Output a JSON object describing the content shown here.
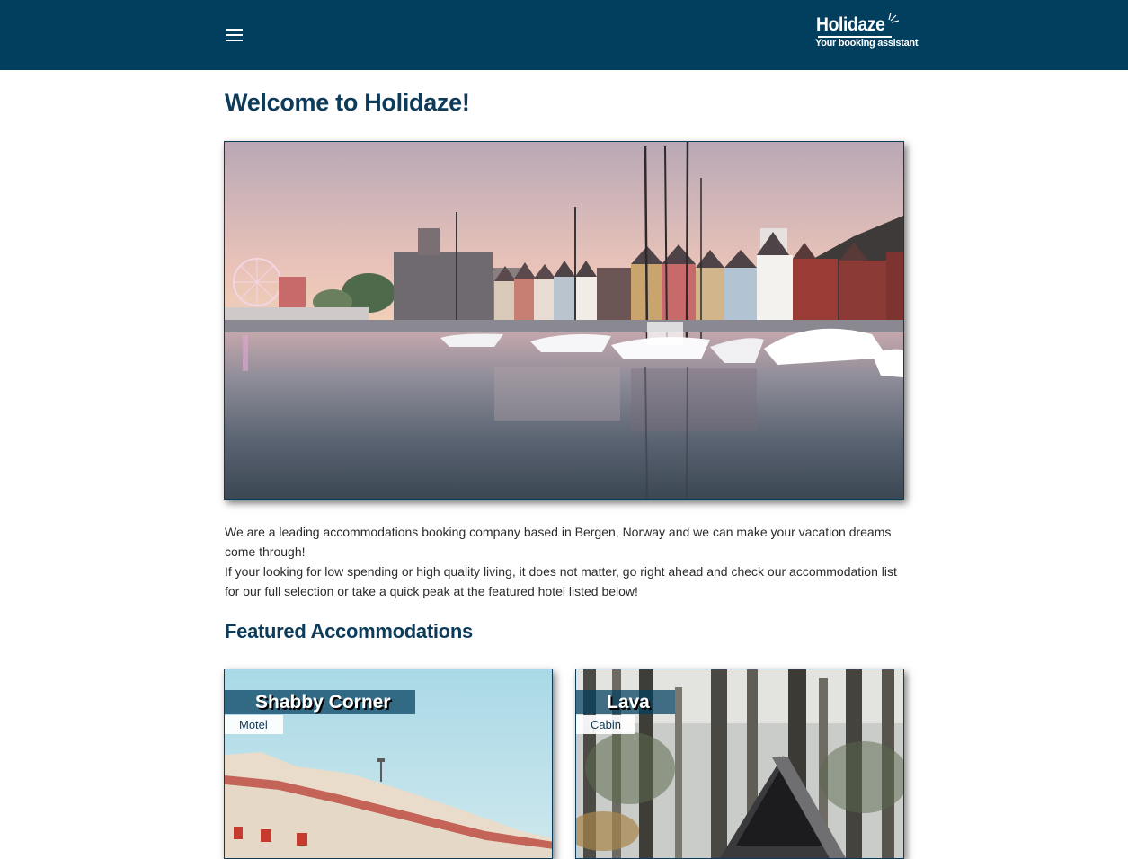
{
  "header": {
    "menu_icon": "hamburger-menu-icon",
    "logo": {
      "name": "Holidaze",
      "tagline": "Your booking assistant"
    },
    "background_color": "#023e5e"
  },
  "main": {
    "title": "Welcome to Holidaze!",
    "hero_image_subject": "Bergen harbour with colorful wooden houses, sailboats and a ferris wheel at sunset",
    "intro": {
      "line1": "We are a leading accommodations booking company based in Bergen, Norway and we can make your vacation dreams come through!",
      "line2": "If your looking for low spending or high quality living, it does not matter, go right ahead and check our accommodation list for our full selection or take a quick peak at the featured hotel listed below!"
    },
    "featured": {
      "title": "Featured Accommodations",
      "cards": [
        {
          "name": "Shabby Corner",
          "type": "Motel"
        },
        {
          "name": "Lava",
          "type": "Cabin"
        }
      ]
    }
  },
  "colors": {
    "brand": "#023e5e",
    "heading": "#0d3b5a",
    "text": "#2b2b2b"
  }
}
